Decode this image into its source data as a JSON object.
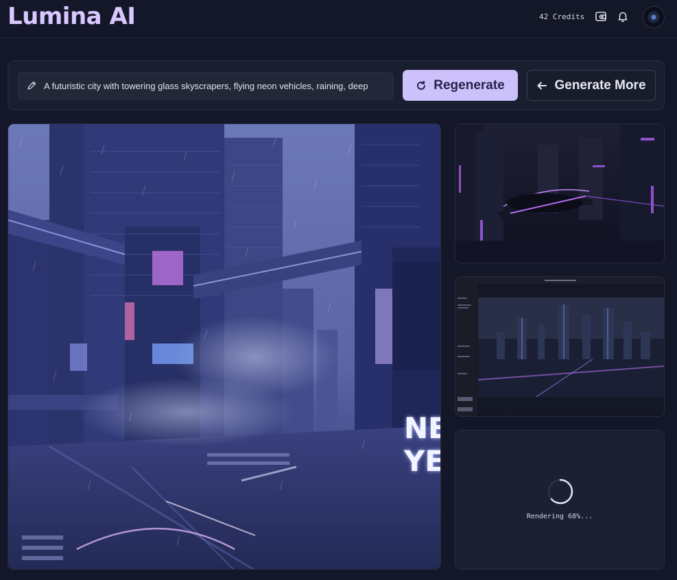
{
  "app": {
    "logo": "Lumina AI",
    "credits": "42 Credits"
  },
  "header": {
    "icons": [
      "wallet-icon",
      "bell-icon"
    ]
  },
  "prompt": {
    "value": "A futuristic city with towering glass skyscrapers, flying neon vehicles, raining, deep"
  },
  "actions": {
    "regenerate_label": "Regenerate",
    "generate_more_label": "Generate More"
  },
  "main_image": {
    "sign_line1": "NEO",
    "sign_line2": "YEA"
  },
  "render": {
    "status_text": "Rendering 68%...",
    "progress": 0.68
  },
  "colors": {
    "background": "#131728",
    "accent": "#ccc1fb",
    "logo": "#d8c8ff"
  }
}
